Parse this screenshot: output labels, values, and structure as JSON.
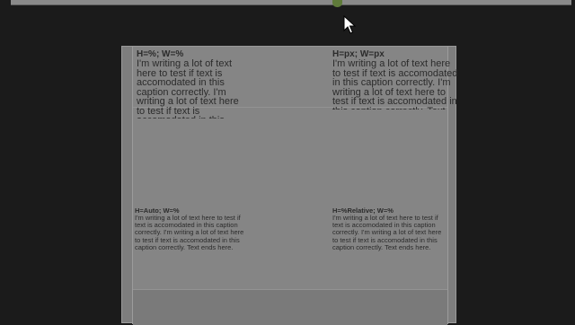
{
  "slider": {
    "position": 0.6
  },
  "captions": {
    "top_left": {
      "title": "H=%; W=%",
      "text": "I'm writing a lot of text here to test if text is accomodated in this caption correctly. I'm writing a lot of text here to test if text is accomodated in this"
    },
    "top_right": {
      "title": "H=px; W=px",
      "text": "I'm writing a lot of text here to test if text is accomodated in this caption correctly. I'm writing a lot of text here to test if text is accomodated in this caption correctly. Text ends here."
    },
    "bottom_left": {
      "title": "H=Auto; W=%",
      "text": "I'm writing a lot of text here to test if text is accomodated in this caption correctly. I'm writing a lot of text here to test if text is accomodated in this caption correctly. Text ends here."
    },
    "bottom_right": {
      "title": "H=%Relative; W=%",
      "text": "I'm writing a lot of text here to test if text is accomodated in this caption correctly. I'm writing a lot of text here to test if text is accomodated in this caption correctly. Text ends here."
    }
  },
  "colors": {
    "background": "#1b1b1b",
    "panel": "#858585",
    "text": "#2b2b2b",
    "slider_thumb": "#5f7b3a"
  },
  "icons": {
    "cursor": "mouse-pointer-icon"
  }
}
